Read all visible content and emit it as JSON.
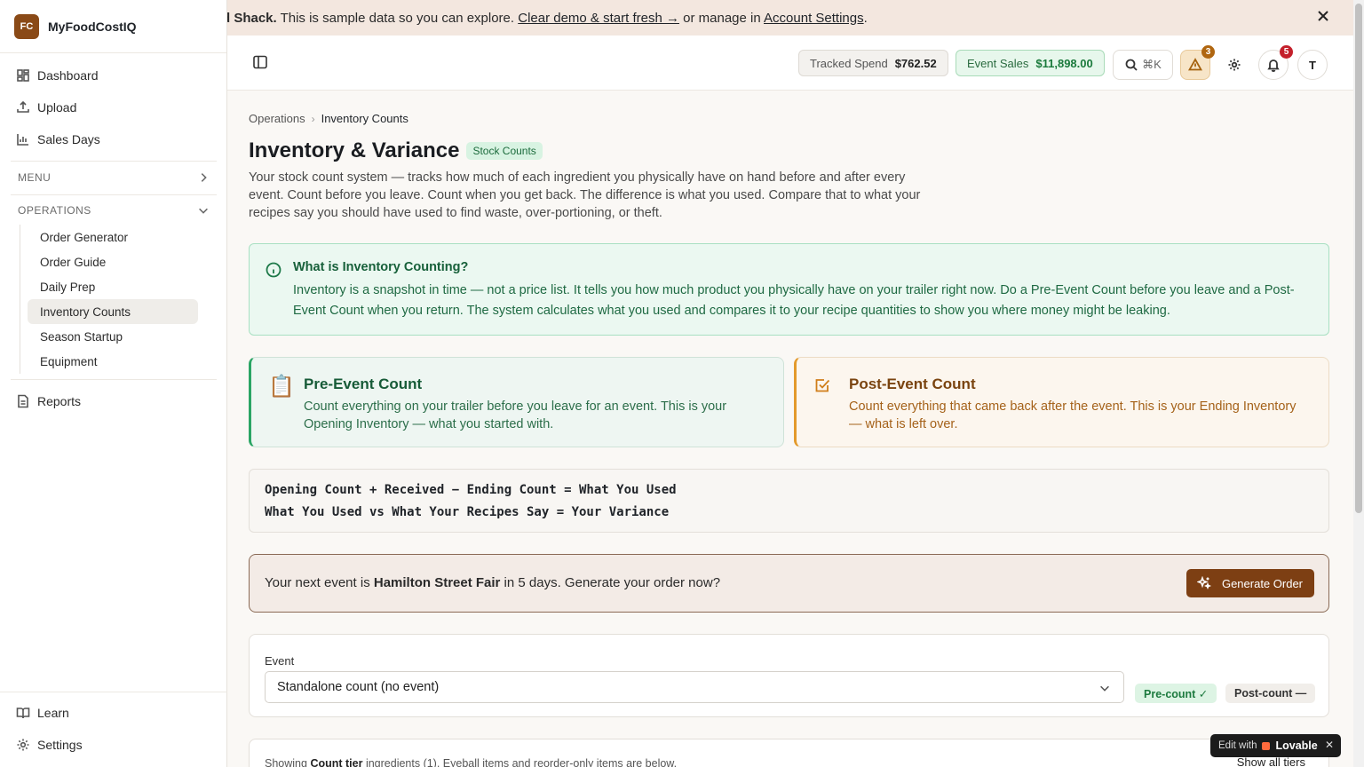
{
  "app": {
    "logo_initials": "FC",
    "name": "MyFoodCostIQ"
  },
  "sidebar": {
    "top_items": [
      {
        "label": "Dashboard",
        "icon": "dashboard-icon"
      },
      {
        "label": "Upload",
        "icon": "upload-icon"
      },
      {
        "label": "Sales Days",
        "icon": "bar-chart-icon"
      }
    ],
    "menu_label": "MENU",
    "operations_label": "OPERATIONS",
    "operations_items": [
      "Order Generator",
      "Order Guide",
      "Daily Prep",
      "Inventory Counts",
      "Season Startup",
      "Equipment"
    ],
    "active_item": "Inventory Counts",
    "reports_label": "Reports",
    "learn_label": "Learn",
    "settings_label": "Settings"
  },
  "banner": {
    "bold_prefix": "d Shack.",
    "text_middle": " This is sample data so you can explore. ",
    "link_clear": "Clear demo & start fresh →",
    "text_or": " or manage in ",
    "link_account": "Account Settings",
    "text_end": "."
  },
  "topbar": {
    "tracked_spend_label": "Tracked Spend",
    "tracked_spend_value": "$762.52",
    "event_sales_label": "Event Sales",
    "event_sales_value": "$11,898.00",
    "search_shortcut": "⌘K",
    "warning_count": "3",
    "notification_count": "5",
    "avatar_initial": "T"
  },
  "breadcrumb": {
    "parent": "Operations",
    "current": "Inventory Counts"
  },
  "page": {
    "title": "Inventory & Variance",
    "badge": "Stock Counts",
    "description": "Your stock count system — tracks how much of each ingredient you physically have on hand before and after every event. Count before you leave. Count when you get back. The difference is what you used. Compare that to what your recipes say you should have used to find waste, over-portioning, or theft."
  },
  "info": {
    "title": "What is Inventory Counting?",
    "body": "Inventory is a snapshot in time — not a price list. It tells you how much product you physically have on your trailer right now. Do a Pre-Event Count before you leave and a Post-Event Count when you return. The system calculates what you used and compares it to your recipe quantities to show you where money might be leaking."
  },
  "pre_card": {
    "icon": "📋",
    "title": "Pre-Event Count",
    "body": "Count everything on your trailer before you leave for an event. This is your Opening Inventory — what you started with."
  },
  "post_card": {
    "title": "Post-Event Count",
    "body": "Count everything that came back after the event. This is your Ending Inventory — what is left over."
  },
  "formula": {
    "line1": "Opening Count + Received − Ending Count = What You Used",
    "line2": "What You Used vs What Your Recipes Say = Your Variance"
  },
  "next_event": {
    "prefix": "Your next event is ",
    "event_name": "Hamilton Street Fair",
    "suffix": " in 5 days. Generate your order now?",
    "button_label": "Generate Order"
  },
  "event_picker": {
    "label": "Event",
    "selected": "Standalone count (no event)",
    "pre_status": "Pre-count ✓",
    "post_status": "Post-count —"
  },
  "tier": {
    "prefix": "Showing ",
    "bold": "Count tier",
    "suffix": " ingredients (1). Eyeball items and reorder-only items are below.",
    "show_all": "Show all tiers"
  },
  "lovable": {
    "prefix": "Edit with",
    "brand": "Lovable",
    "close": "✕"
  }
}
